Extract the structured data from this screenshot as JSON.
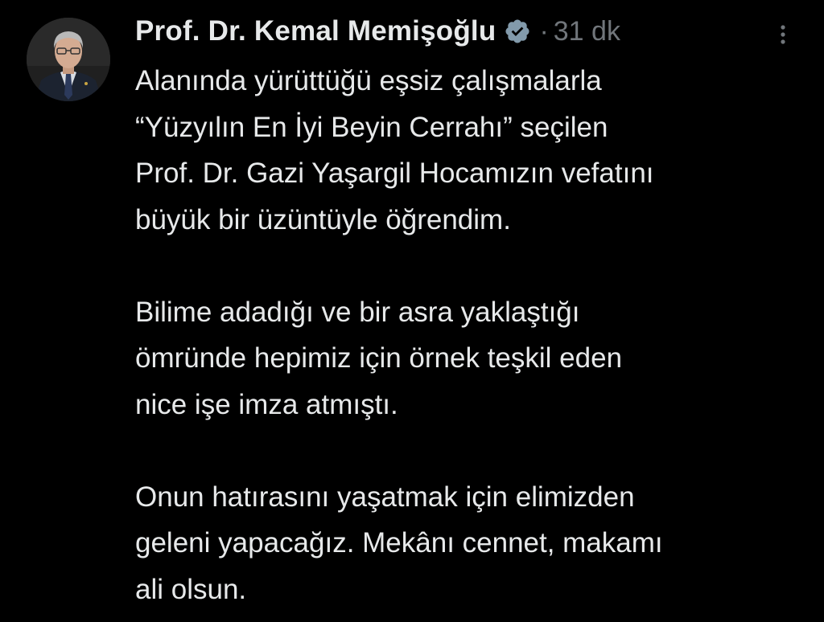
{
  "author": {
    "display_name": "Prof. Dr. Kemal Memişoğlu",
    "verified": true,
    "verified_icon": "verified-badge-icon",
    "avatar_icon": "profile-photo"
  },
  "meta": {
    "separator": "·",
    "time": "31 dk"
  },
  "menu_icon": "more-options-icon",
  "tweet_text": {
    "paragraph1": [
      "Alanında yürüttüğü eşsiz çalışmalarla",
      "“Yüzyılın En İyi Beyin Cerrahı” seçilen",
      "Prof. Dr. Gazi Yaşargil Hocamızın vefatını",
      "büyük bir üzüntüyle öğrendim."
    ],
    "paragraph2": [
      "Bilime adadığı ve bir asra yaklaştığı",
      "ömründe hepimiz için örnek teşkil eden",
      "nice işe imza atmıştı."
    ],
    "paragraph3": [
      "Onun hatırasını yaşatmak için elimizden",
      "geleni yapacağız. Mekânı cennet, makamı",
      "ali olsun."
    ]
  },
  "colors": {
    "background": "#000000",
    "text": "#e7e9ea",
    "secondary": "#71767b",
    "verified": "#829aab"
  }
}
